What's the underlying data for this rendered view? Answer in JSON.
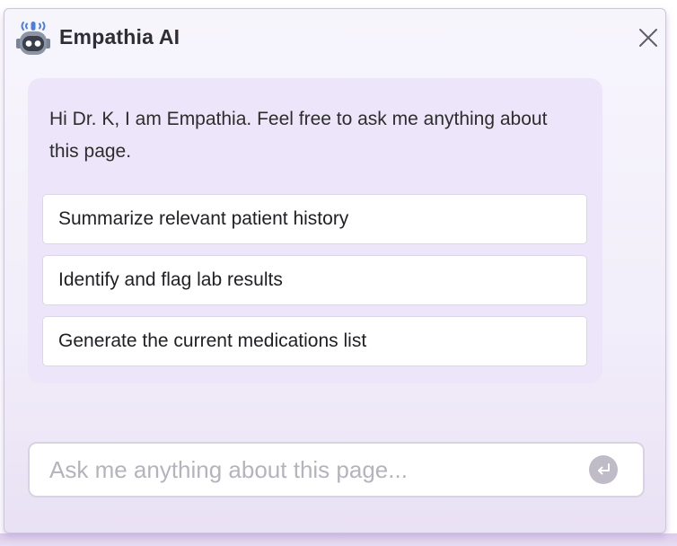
{
  "header": {
    "title": "Empathia AI",
    "logo_icon": "robot-icon",
    "close_icon": "close-icon"
  },
  "message": {
    "greeting": "Hi Dr. K, I am Empathia. Feel free to ask me anything about this page."
  },
  "suggestions": [
    {
      "label": "Summarize relevant patient history"
    },
    {
      "label": "Identify and flag lab results"
    },
    {
      "label": "Generate the current medications list"
    }
  ],
  "chat_input": {
    "value": "",
    "placeholder": "Ask me anything about this page...",
    "send_icon": "enter-return-icon"
  },
  "colors": {
    "panel_bg": "#f3effa",
    "card_bg": "#ede6fa",
    "logo_accent": "#4a7fe0",
    "text_primary": "#2d2d2d",
    "send_button": "#bfbcc8"
  }
}
